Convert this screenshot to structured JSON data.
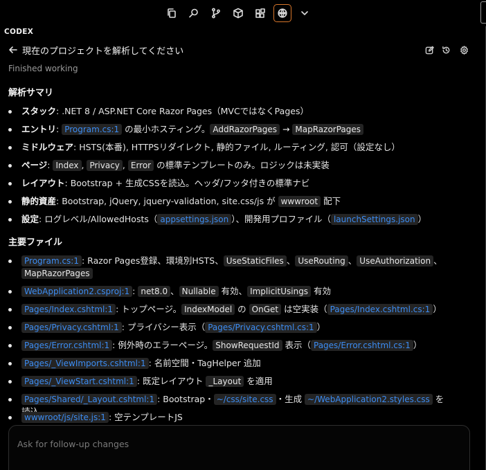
{
  "toolbar": {
    "icons": [
      "copy-icon",
      "search-icon",
      "source-control-icon",
      "package-icon",
      "extensions-icon",
      "codex-icon",
      "chevron-down-icon"
    ],
    "accent": "#d9772b"
  },
  "panel": {
    "label": "CODEX"
  },
  "header": {
    "title": "現在のプロジェクトを解析してください"
  },
  "status": "Finished working",
  "sections": {
    "summary": "解析サマリ",
    "files": "主要ファイル"
  },
  "summary": {
    "s1": {
      "label": "スタック",
      "text": ": .NET 8 / ASP.NET Core Razor Pages（MVCではなくPages）"
    },
    "s2": {
      "label": "エントリ",
      "sep": ": ",
      "link": "Program.cs:1",
      "mid": " の最小ホスティング。",
      "c1": "AddRazorPages",
      "arrow": " → ",
      "c2": "MapRazorPages"
    },
    "s3": {
      "label": "ミドルウェア",
      "text": ": HSTS(本番), HTTPSリダイレクト, 静的ファイル, ルーティング, 認可（設定なし）"
    },
    "s4": {
      "label": "ページ",
      "sep": ": ",
      "c1": "Index",
      "comma1": ", ",
      "c2": "Privacy",
      "comma2": ", ",
      "c3": "Error",
      "rest": " の標準テンプレートのみ。ロジックは未実装"
    },
    "s5": {
      "label": "レイアウト",
      "text": ": Bootstrap + 生成CSSを読込。ヘッダ/フッタ付きの標準ナビ"
    },
    "s6": {
      "label": "静的資産",
      "text": ": Bootstrap, jQuery, jquery-validation, site.css/js が ",
      "c1": "wwwroot",
      "rest": " 配下"
    },
    "s7": {
      "label": "設定",
      "text": ": ログレベル/AllowedHosts（",
      "link1": "appsettings.json",
      "mid": "）、開発用プロファイル（",
      "link2": "launchSettings.json",
      "end": "）"
    }
  },
  "files": {
    "f1": {
      "link": "Program.cs:1",
      "text": ": Razor Pages登録、環境別HSTS、",
      "c1": "UseStaticFiles",
      "s1": "、",
      "c2": "UseRouting",
      "s2": "、",
      "c3": "UseAuthorization",
      "s3": "、",
      "c4": "MapRazorPages"
    },
    "f2": {
      "link": "WebApplication2.csproj:1",
      "text": ": ",
      "c1": "net8.0",
      "s1": "、",
      "c2": "Nullable",
      "s2": " 有効、",
      "c3": "ImplicitUsings",
      "s3": " 有効"
    },
    "f3": {
      "link": "Pages/Index.cshtml:1",
      "text": ": トップページ。",
      "c1": "IndexModel",
      "s1": " の ",
      "c2": "OnGet",
      "s2": " は空実装（",
      "link2": "Pages/Index.cshtml.cs:1",
      "end": "）"
    },
    "f4": {
      "link": "Pages/Privacy.cshtml:1",
      "text": ": プライバシー表示（",
      "link2": "Pages/Privacy.cshtml.cs:1",
      "end": "）"
    },
    "f5": {
      "link": "Pages/Error.cshtml:1",
      "text": ": 例外時のエラーページ。",
      "c1": "ShowRequestId",
      "s1": " 表示（",
      "link2": "Pages/Error.cshtml.cs:1",
      "end": "）"
    },
    "f6": {
      "link": "Pages/_ViewImports.cshtml:1",
      "text": ": 名前空間・TagHelper 追加"
    },
    "f7": {
      "link": "Pages/_ViewStart.cshtml:1",
      "text": ": 既定レイアウト ",
      "c1": "_Layout",
      "s1": " を適用"
    },
    "f8": {
      "link": "Pages/Shared/_Layout.cshtml:1",
      "text": ": Bootstrap・",
      "link2": "~/css/site.css",
      "s1": "・生成 ",
      "link3": "~/WebApplication2.styles.css",
      "end": " を読込"
    },
    "f9": {
      "link": "wwwroot/js/site.js:1",
      "text": ": 空テンプレートJS"
    }
  },
  "composer": {
    "placeholder": "Ask for follow-up changes"
  }
}
